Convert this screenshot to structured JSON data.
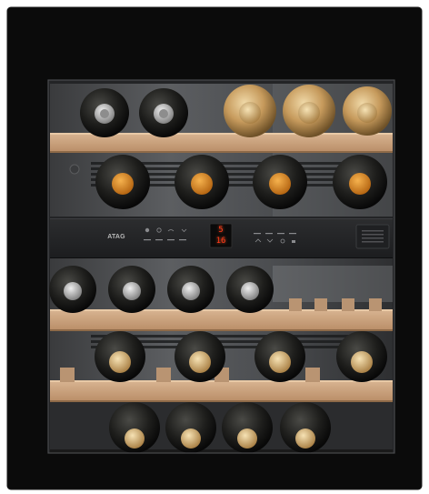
{
  "appliance": {
    "brand": "ATAG",
    "display": {
      "temp_top": "5",
      "temp_bottom": "16"
    }
  },
  "colors": {
    "background": "#ffffff",
    "glass_frame": "#0b0b0b",
    "interior": "#2a2b2d",
    "shelf_wood": "#c7a07e",
    "display_digits": "#ff3a1a",
    "capsule_gold": "#c9a06a",
    "capsule_orange": "#e08a1e",
    "capsule_silver": "#b8b8b8"
  },
  "icons": {
    "left_buttons": [
      "light-icon",
      "power-icon",
      "wifi-icon",
      "chevron-down-icon"
    ],
    "right_buttons": [
      "zone-up-icon",
      "zone-down-icon",
      "settings-icon",
      "lock-icon"
    ]
  }
}
